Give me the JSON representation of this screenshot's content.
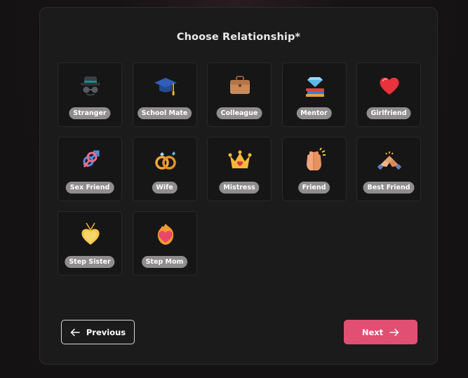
{
  "form": {
    "title": "Choose Relationship*"
  },
  "relationships": [
    {
      "label": "Stranger",
      "icon": "spy-hat-icon"
    },
    {
      "label": "School Mate",
      "icon": "graduation-cap-icon"
    },
    {
      "label": "Colleague",
      "icon": "briefcase-icon"
    },
    {
      "label": "Mentor",
      "icon": "diamond-books-icon"
    },
    {
      "label": "Girlfriend",
      "icon": "red-heart-icon"
    },
    {
      "label": "Sex Friend",
      "icon": "gender-symbols-icon"
    },
    {
      "label": "Wife",
      "icon": "wedding-rings-icon"
    },
    {
      "label": "Mistress",
      "icon": "crown-icon"
    },
    {
      "label": "Friend",
      "icon": "high-five-icon"
    },
    {
      "label": "Best Friend",
      "icon": "handshake-icon"
    },
    {
      "label": "Step Sister",
      "icon": "heart-pendant-icon"
    },
    {
      "label": "Step Mom",
      "icon": "flaming-heart-icon"
    }
  ],
  "nav": {
    "previous_label": "Previous",
    "next_label": "Next"
  },
  "colors": {
    "accent": "#e14f73",
    "tile_label_bg": "#8f8d8d",
    "card_bg": "#1c1b1b"
  }
}
